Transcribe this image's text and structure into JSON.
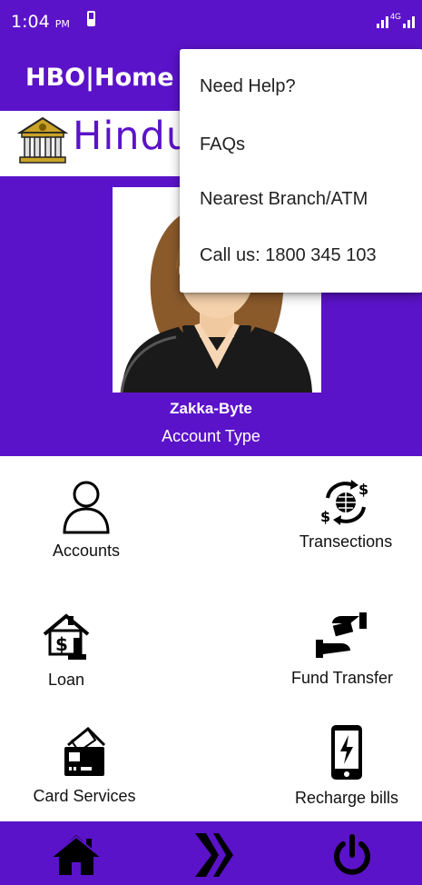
{
  "status_bar": {
    "time": "1:04",
    "ampm": "PM",
    "network": "4G"
  },
  "app_bar": {
    "title": "HBO|Home"
  },
  "brand": {
    "text": "Hindust"
  },
  "profile": {
    "name": "Zakka-Byte",
    "account_type": "Account Type"
  },
  "menu": {
    "accounts": "Accounts",
    "transections": "Transections",
    "loan": "Loan",
    "fund_transfer": "Fund Transfer",
    "card_services": "Card Services",
    "recharge_bills": "Recharge bills"
  },
  "overflow_menu": {
    "items": [
      "Need Help?",
      "FAQs",
      "Nearest Branch/ATM",
      "Call us:  1800 345 103"
    ]
  },
  "bottom_nav": {
    "icons": [
      "home-icon",
      "logo-icon",
      "power-icon"
    ]
  },
  "colors": {
    "primary": "#5b13c9",
    "icon": "#000000"
  }
}
